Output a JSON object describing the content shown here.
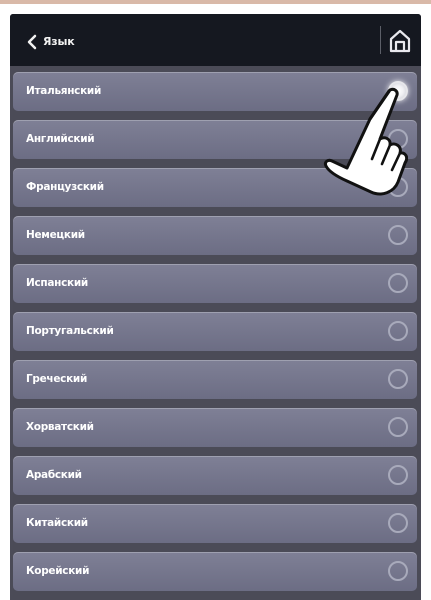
{
  "header": {
    "title": "Язык",
    "back_icon": "chevron-left-icon",
    "home_icon": "home-icon"
  },
  "languages": [
    {
      "label": "Итальянский",
      "selected": true
    },
    {
      "label": "Английский",
      "selected": false
    },
    {
      "label": "Французский",
      "selected": false
    },
    {
      "label": "Немецкий",
      "selected": false
    },
    {
      "label": "Испанский",
      "selected": false
    },
    {
      "label": "Португальский",
      "selected": false
    },
    {
      "label": "Греческий",
      "selected": false
    },
    {
      "label": "Хорватский",
      "selected": false
    },
    {
      "label": "Арабский",
      "selected": false
    },
    {
      "label": "Китайский",
      "selected": false
    },
    {
      "label": "Корейский",
      "selected": false
    }
  ],
  "overlay": {
    "pointer_icon": "hand-pointer-icon"
  },
  "colors": {
    "header_background": "#151820",
    "row_background": "#777890",
    "frame_background": "#4b4b57",
    "selected_radio": "#ffffff"
  }
}
